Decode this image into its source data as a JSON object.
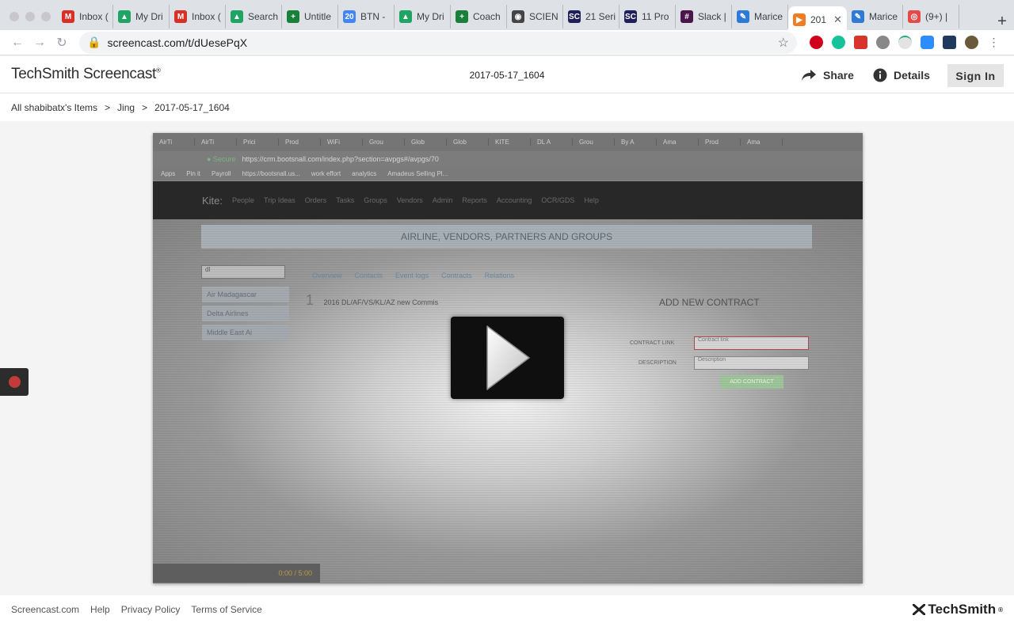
{
  "browser": {
    "tabs": [
      {
        "label": "Inbox (",
        "favicon": "gmail-icon",
        "color": "#d93025",
        "glyph": "M"
      },
      {
        "label": "My Dri",
        "favicon": "drive-icon",
        "color": "#1fa463",
        "glyph": "▲"
      },
      {
        "label": "Inbox (",
        "favicon": "gmail-icon",
        "color": "#d93025",
        "glyph": "M"
      },
      {
        "label": "Search",
        "favicon": "drive-icon",
        "color": "#1fa463",
        "glyph": "▲"
      },
      {
        "label": "Untitle",
        "favicon": "sheets-icon",
        "color": "#188038",
        "glyph": "+"
      },
      {
        "label": "BTN -",
        "favicon": "calendar-icon",
        "color": "#4285f4",
        "glyph": "20"
      },
      {
        "label": "My Dri",
        "favicon": "drive-icon",
        "color": "#1fa463",
        "glyph": "▲"
      },
      {
        "label": "Coach",
        "favicon": "sheets-icon",
        "color": "#188038",
        "glyph": "+"
      },
      {
        "label": "SCIEN",
        "favicon": "globe-icon",
        "color": "#444444",
        "glyph": "◉"
      },
      {
        "label": "21 Seri",
        "favicon": "sc-icon",
        "color": "#1f1f5c",
        "glyph": "SC"
      },
      {
        "label": "11 Pro",
        "favicon": "sc-icon",
        "color": "#1f1f5c",
        "glyph": "SC"
      },
      {
        "label": "Slack |",
        "favicon": "slack-icon",
        "color": "#4a154b",
        "glyph": "#"
      },
      {
        "label": "Marice",
        "favicon": "pen-icon",
        "color": "#2f7ad6",
        "glyph": "✎"
      },
      {
        "label": "201",
        "favicon": "screencast-icon",
        "color": "#f07c24",
        "glyph": "▶",
        "active": true
      },
      {
        "label": "Marice",
        "favicon": "pen-icon",
        "color": "#2f7ad6",
        "glyph": "✎"
      },
      {
        "label": "(9+) | ",
        "favicon": "lattice-icon",
        "color": "#e34a4a",
        "glyph": "◎"
      }
    ],
    "url": "screencast.com/t/dUesePqX"
  },
  "header": {
    "logo": "TechSmith Screencast",
    "title": "2017-05-17_1604",
    "share": "Share",
    "details": "Details",
    "sign_in": "Sign In"
  },
  "breadcrumb": {
    "items": [
      "All shabibatx's Items",
      "Jing",
      "2017-05-17_1604"
    ],
    "separator": ">"
  },
  "video": {
    "inner_tabs": [
      "AirTi",
      "AirTi",
      "Prici",
      "Prod",
      "WiFi",
      "Grou",
      "Glob",
      "Glob",
      "KITE",
      "DL A",
      "Grou",
      "By A",
      "Ama",
      "Prod",
      "Ama"
    ],
    "inner_url": "https://crm.bootsnall.com/index.php?section=avpgs#/avpgs/70",
    "bookmarks": [
      "Apps",
      "Pin it",
      "Payroll",
      "https://bootsnall.us...",
      "work effort",
      "analytics",
      "Amadeus Selling Pl..."
    ],
    "nav_brand": "Kite:",
    "nav_items": [
      "People",
      "Trip Ideas",
      "Orders",
      "Tasks",
      "Groups",
      "Vendors",
      "Admin",
      "Reports",
      "Accounting",
      "OCR/GDS",
      "Help"
    ],
    "banner": "AIRLINE, VENDORS, PARTNERS AND GROUPS",
    "search_value": "dl",
    "list_items": [
      "Air Madagascar",
      "Delta Airlines",
      "Middle East Ai"
    ],
    "detail_tabs": [
      "Overview",
      "Contacts",
      "Event logs",
      "Contracts",
      "Relations"
    ],
    "item_number": "1",
    "item_title": "2016 DL/AF/VS/KL/AZ new Commis",
    "contract_title": "ADD NEW CONTRACT",
    "contract_link_label": "CONTRACT LINK",
    "description_label": "DESCRIPTION",
    "contract_link_placeholder": "Contract link",
    "description_placeholder": "Description",
    "add_contract": "ADD CONTRACT",
    "time": "0:00 / 5:00"
  },
  "footer": {
    "links": [
      "Screencast.com",
      "Help",
      "Privacy Policy",
      "Terms of Service"
    ],
    "brand": "TechSmith"
  }
}
